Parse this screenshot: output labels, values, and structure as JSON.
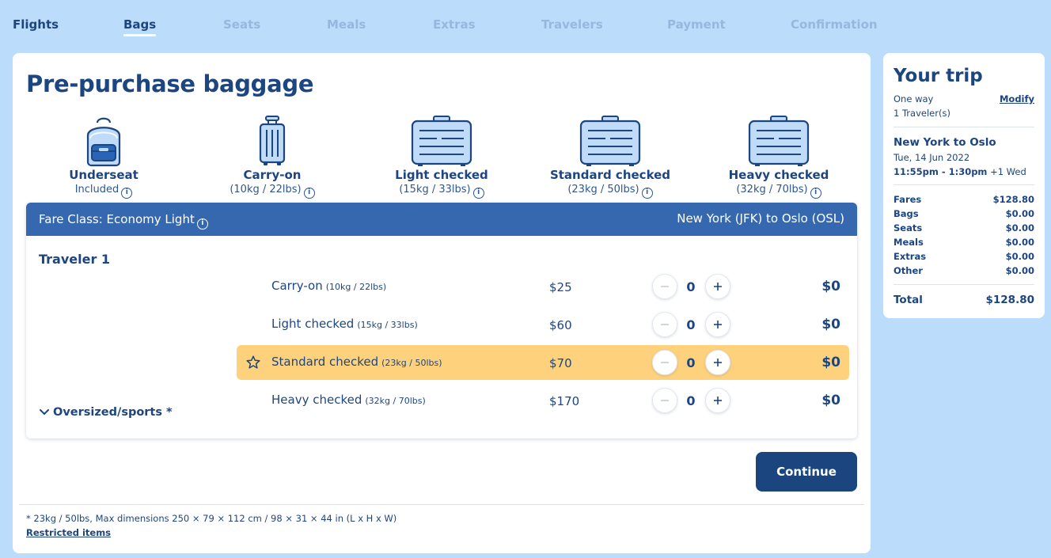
{
  "steps": [
    {
      "label": "Flights",
      "state": "done"
    },
    {
      "label": "Bags",
      "state": "active"
    },
    {
      "label": "Seats",
      "state": "upcoming"
    },
    {
      "label": "Meals",
      "state": "upcoming"
    },
    {
      "label": "Extras",
      "state": "upcoming"
    },
    {
      "label": "Travelers",
      "state": "upcoming"
    },
    {
      "label": "Payment",
      "state": "upcoming"
    },
    {
      "label": "Confirmation",
      "state": "upcoming"
    }
  ],
  "page_title": "Pre-purchase baggage",
  "bag_types": [
    {
      "name": "Underseat",
      "detail": "Included",
      "icon": "backpack-icon"
    },
    {
      "name": "Carry-on",
      "detail": "(10kg / 22lbs)",
      "icon": "rolling-suitcase-icon"
    },
    {
      "name": "Light checked",
      "detail": "(15kg / 33lbs)",
      "icon": "suitcase-icon"
    },
    {
      "name": "Standard checked",
      "detail": "(23kg / 50lbs)",
      "icon": "suitcase-icon"
    },
    {
      "name": "Heavy checked",
      "detail": "(32kg / 70lbs)",
      "icon": "suitcase-icon"
    }
  ],
  "fare": {
    "class_label": "Fare Class: Economy Light",
    "route": "New York (JFK) to Oslo (OSL)"
  },
  "traveler": {
    "name": "Traveler 1",
    "oversized_label": "Oversized/sports *",
    "rows": [
      {
        "name": "Carry-on",
        "weight": "(10kg / 22lbs)",
        "price": "$25",
        "qty": "0",
        "total": "$0",
        "recommended": false
      },
      {
        "name": "Light checked",
        "weight": "(15kg / 33lbs)",
        "price": "$60",
        "qty": "0",
        "total": "$0",
        "recommended": false
      },
      {
        "name": "Standard checked",
        "weight": "(23kg / 50lbs)",
        "price": "$70",
        "qty": "0",
        "total": "$0",
        "recommended": true
      },
      {
        "name": "Heavy checked",
        "weight": "(32kg / 70lbs)",
        "price": "$170",
        "qty": "0",
        "total": "$0",
        "recommended": false
      }
    ]
  },
  "continue_label": "Continue",
  "footnote": "* 23kg / 50lbs, Max dimensions 250 × 79 × 112 cm / 98 × 31 × 44 in (L x H x W)",
  "restricted_link": "Restricted items",
  "trip": {
    "title": "Your trip",
    "type": "One way",
    "modify": "Modify",
    "travelers": "1 Traveler(s)",
    "route": "New York to Oslo",
    "date": "Tue, 14 Jun 2022",
    "times": "11:55pm - 1:30pm",
    "next_day": "+1 Wed",
    "costs": [
      {
        "label": "Fares",
        "value": "$128.80"
      },
      {
        "label": "Bags",
        "value": "$0.00"
      },
      {
        "label": "Seats",
        "value": "$0.00"
      },
      {
        "label": "Meals",
        "value": "$0.00"
      },
      {
        "label": "Extras",
        "value": "$0.00"
      },
      {
        "label": "Other",
        "value": "$0.00"
      }
    ],
    "total_label": "Total",
    "total_value": "$128.80"
  },
  "colors": {
    "background": "#bcdcfb",
    "primary_text": "#1d4580",
    "fare_header": "#3668b0",
    "highlight_row": "#fed27d",
    "button": "#1a457e",
    "inactive_tab": "#96b8df"
  }
}
